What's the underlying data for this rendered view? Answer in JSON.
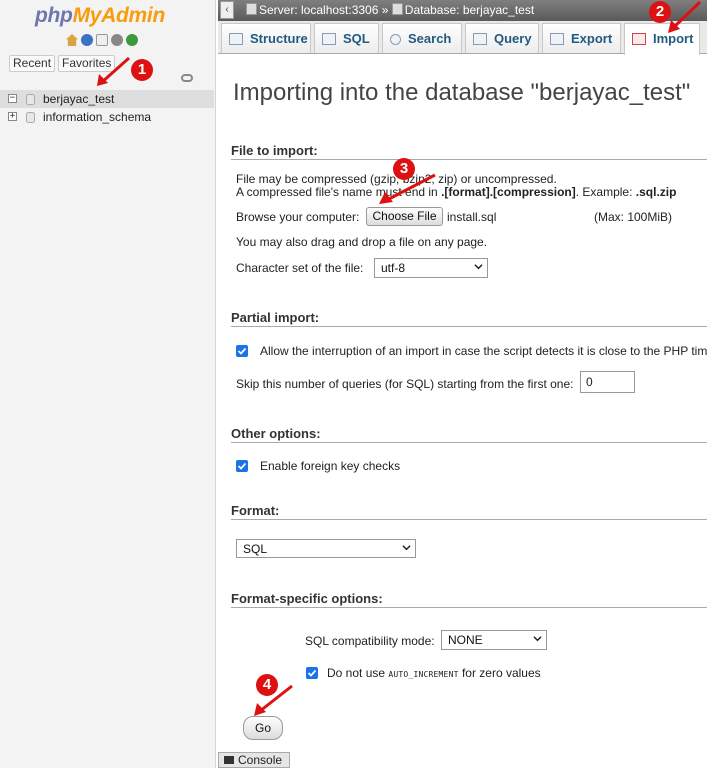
{
  "nav": {
    "logo_php": "php",
    "logo_my": "MyAdmin",
    "icons": [
      "home-icon",
      "help-icon",
      "docs-icon",
      "settings-icon",
      "reload-icon"
    ],
    "tab_recent": "Recent",
    "tab_favorites": "Favorites",
    "databases": [
      {
        "name": "berjayac_test",
        "expander": "−",
        "active": true
      },
      {
        "name": "information_schema",
        "expander": "+",
        "active": false
      }
    ]
  },
  "topbar": {
    "server": "Server: localhost:3306",
    "separator": "»",
    "database": "Database: berjayac_test"
  },
  "tabs": [
    {
      "label": "Structure",
      "icon": "structure-icon"
    },
    {
      "label": "SQL",
      "icon": "sql-icon"
    },
    {
      "label": "Search",
      "icon": "search-icon"
    },
    {
      "label": "Query",
      "icon": "query-icon"
    },
    {
      "label": "Export",
      "icon": "export-icon"
    },
    {
      "label": "Import",
      "icon": "import-icon",
      "active": true
    }
  ],
  "main": {
    "title": "Importing into the database \"berjayac_test\"",
    "file_section": {
      "heading": "File to import:",
      "line1": "File may be compressed (gzip, bzip2, zip) or uncompressed.",
      "line2_prefix": "A compressed file's name must end in ",
      "line2_format": ".[format].[compression]",
      "line2_mid": ". Example: ",
      "line2_example": ".sql.zip",
      "browse_label": "Browse your computer:",
      "choose_button": "Choose File",
      "chosen_file": "install.sql",
      "max_size": "(Max: 100MiB)",
      "drag_text": "You may also drag and drop a file on any page.",
      "charset_label": "Character set of the file:",
      "charset_value": "utf-8"
    },
    "partial_section": {
      "heading": "Partial import:",
      "allow_interrupt": "Allow the interruption of an import in case the script detects it is close to the PHP timeout limit.",
      "skip_label": "Skip this number of queries (for SQL) starting from the first one:",
      "skip_value": "0"
    },
    "other_section": {
      "heading": "Other options:",
      "foreign_keys": "Enable foreign key checks"
    },
    "format_section": {
      "heading": "Format:",
      "format_value": "SQL"
    },
    "format_specific": {
      "heading": "Format-specific options:",
      "compat_label": "SQL compatibility mode:",
      "compat_value": "NONE",
      "no_auto_prefix": "Do not use ",
      "no_auto_code": "AUTO_INCREMENT",
      "no_auto_suffix": " for zero values"
    },
    "go_button": "Go"
  },
  "console": {
    "label": "Console"
  },
  "annotations": [
    "1",
    "2",
    "3",
    "4"
  ],
  "colors": {
    "accent": "#235a81",
    "annotation": "#dd1111",
    "checkbox": "#1a73e8"
  }
}
